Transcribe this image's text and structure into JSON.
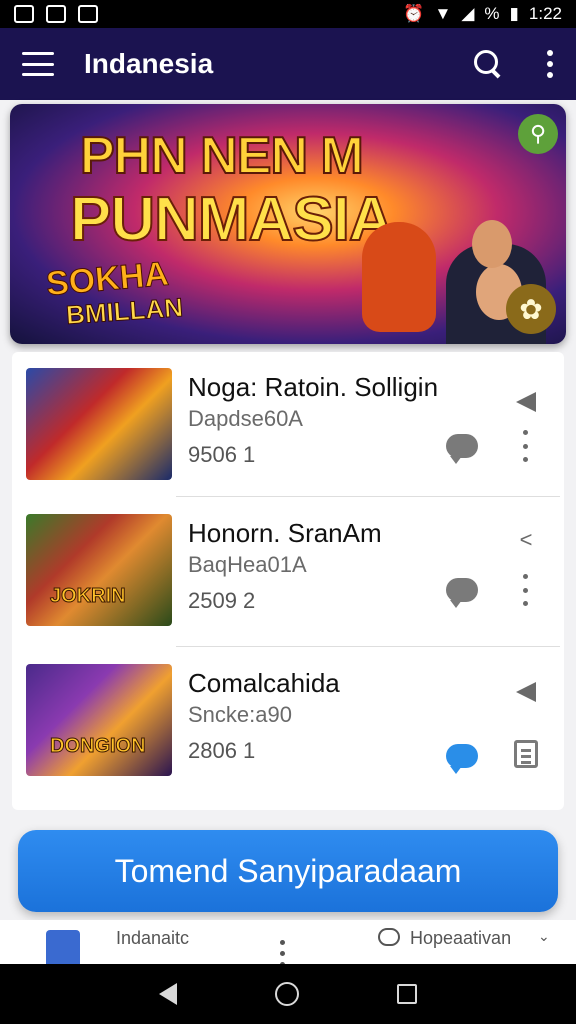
{
  "status_bar": {
    "battery": "%",
    "time": "1:22"
  },
  "app_bar": {
    "title": "Indanesia",
    "icons": [
      "menu-icon",
      "search-icon",
      "more-vert-icon"
    ]
  },
  "banner": {
    "title_line1": "PHN NEN M",
    "title_line2": "PUNMASIA",
    "logo_line1": "SOKHA",
    "logo_line2": "BMILLAN"
  },
  "list": {
    "items": [
      {
        "title": "Noga: Ratoin. Solligin",
        "subtitle": "Dapdse60A",
        "meta": "9506  1",
        "thumb_label": "",
        "actions": [
          "send-icon",
          "chat-icon",
          "more-vert-icon"
        ]
      },
      {
        "title": "Honorn. SranAm",
        "subtitle": "BaqHea01A",
        "meta": "2509  2",
        "thumb_label": "JOKRIN",
        "actions": [
          "share-icon",
          "chat-icon",
          "more-vert-icon"
        ]
      },
      {
        "title": "Comalcahida",
        "subtitle": "Sncke:a90",
        "meta": "2806  1",
        "thumb_label": "DONGION",
        "actions": [
          "send-icon",
          "chat-icon",
          "clipboard-icon"
        ]
      }
    ]
  },
  "cta": {
    "label": "Tomend Sanyiparadaam"
  },
  "bottom_strip": {
    "left_text": "Indanaitc",
    "right_text": "Hopeaativan"
  },
  "colors": {
    "app_bar": "#1b1350",
    "cta": "#2280e4",
    "chat_active": "#2a8ee8"
  }
}
